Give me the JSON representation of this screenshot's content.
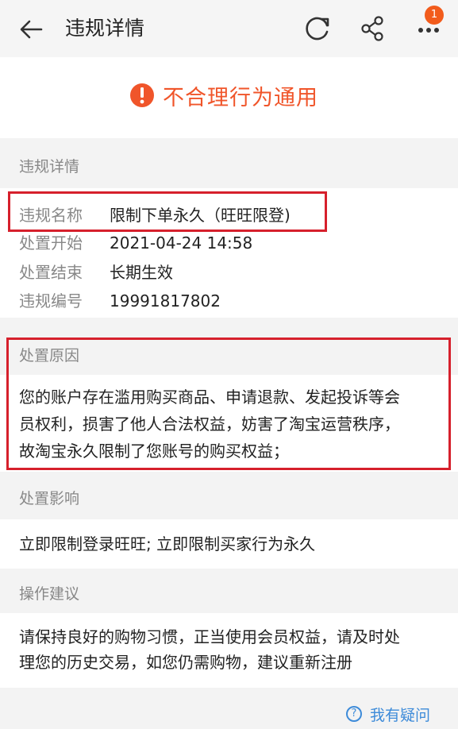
{
  "header": {
    "title": "违规详情",
    "badge_count": "1",
    "icons": [
      "back-arrow-icon",
      "refresh-icon",
      "share-icon",
      "more-icon"
    ]
  },
  "banner": {
    "text": "不合理行为通用",
    "icon": "warning-icon",
    "color": "#f0552a"
  },
  "details": {
    "section_label": "违规详情",
    "rows": [
      {
        "key": "违规名称",
        "value": "限制下单永久（旺旺限登)"
      },
      {
        "key": "处置开始",
        "value": "2021-04-24 14:58"
      },
      {
        "key": "处置结束",
        "value": "长期生效"
      },
      {
        "key": "违规编号",
        "value": "19991817802"
      }
    ]
  },
  "reason": {
    "section_label": "处置原因",
    "lines": [
      "您的账户存在滥用购买商品、申请退款、发起投诉等会",
      "员权利，损害了他人合法权益，妨害了淘宝运营秩序，",
      "故淘宝永久限制了您账号的购买权益；"
    ]
  },
  "impact": {
    "section_label": "处置影响",
    "text": "立即限制登录旺旺; 立即限制买家行为永久"
  },
  "suggestion": {
    "section_label": "操作建议",
    "lines": [
      "请保持良好的购物习惯，正当使用会员权益，请及时处",
      "理您的历史交易，如您仍需购物，建议重新注册"
    ]
  },
  "help": {
    "label": "我有疑问",
    "icon": "question-icon",
    "glyph": "?"
  },
  "colors": {
    "accent": "#f0552a",
    "badge": "#f25c1c",
    "highlight_border": "#d6202c",
    "link": "#3d8bd9"
  }
}
